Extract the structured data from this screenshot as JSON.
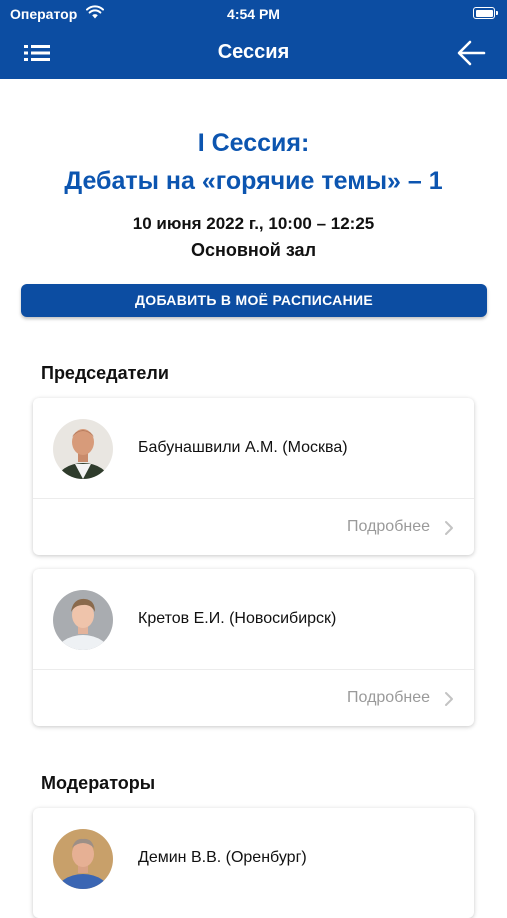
{
  "status_bar": {
    "carrier": "Оператор",
    "time": "4:54 PM"
  },
  "header": {
    "title": "Сессия",
    "background": "#0c4da2"
  },
  "session": {
    "title_line1": "I Сессия:",
    "title_line2": "Дебаты на «горячие темы» – 1",
    "datetime": "10 июня 2022 г., 10:00 – 12:25",
    "room": "Основной зал",
    "add_button_label": "ДОБАВИТЬ В МОЁ РАСПИСАНИЕ",
    "accent_color": "#0c55b0"
  },
  "chairs": {
    "heading": "Председатели",
    "people": [
      {
        "name": "Бабунашвили А.М. (Москва)",
        "more_label": "Подробнее"
      },
      {
        "name": "Кретов Е.И. (Новосибирск)",
        "more_label": "Подробнее"
      }
    ]
  },
  "moderators": {
    "heading": "Модераторы",
    "people": [
      {
        "name": "Демин В.В. (Оренбург)"
      }
    ]
  },
  "icons": {
    "menu": "list-menu-icon",
    "back": "arrow-left-icon",
    "wifi": "wifi-icon",
    "battery": "battery-icon",
    "chevron": "chevron-right-icon"
  }
}
